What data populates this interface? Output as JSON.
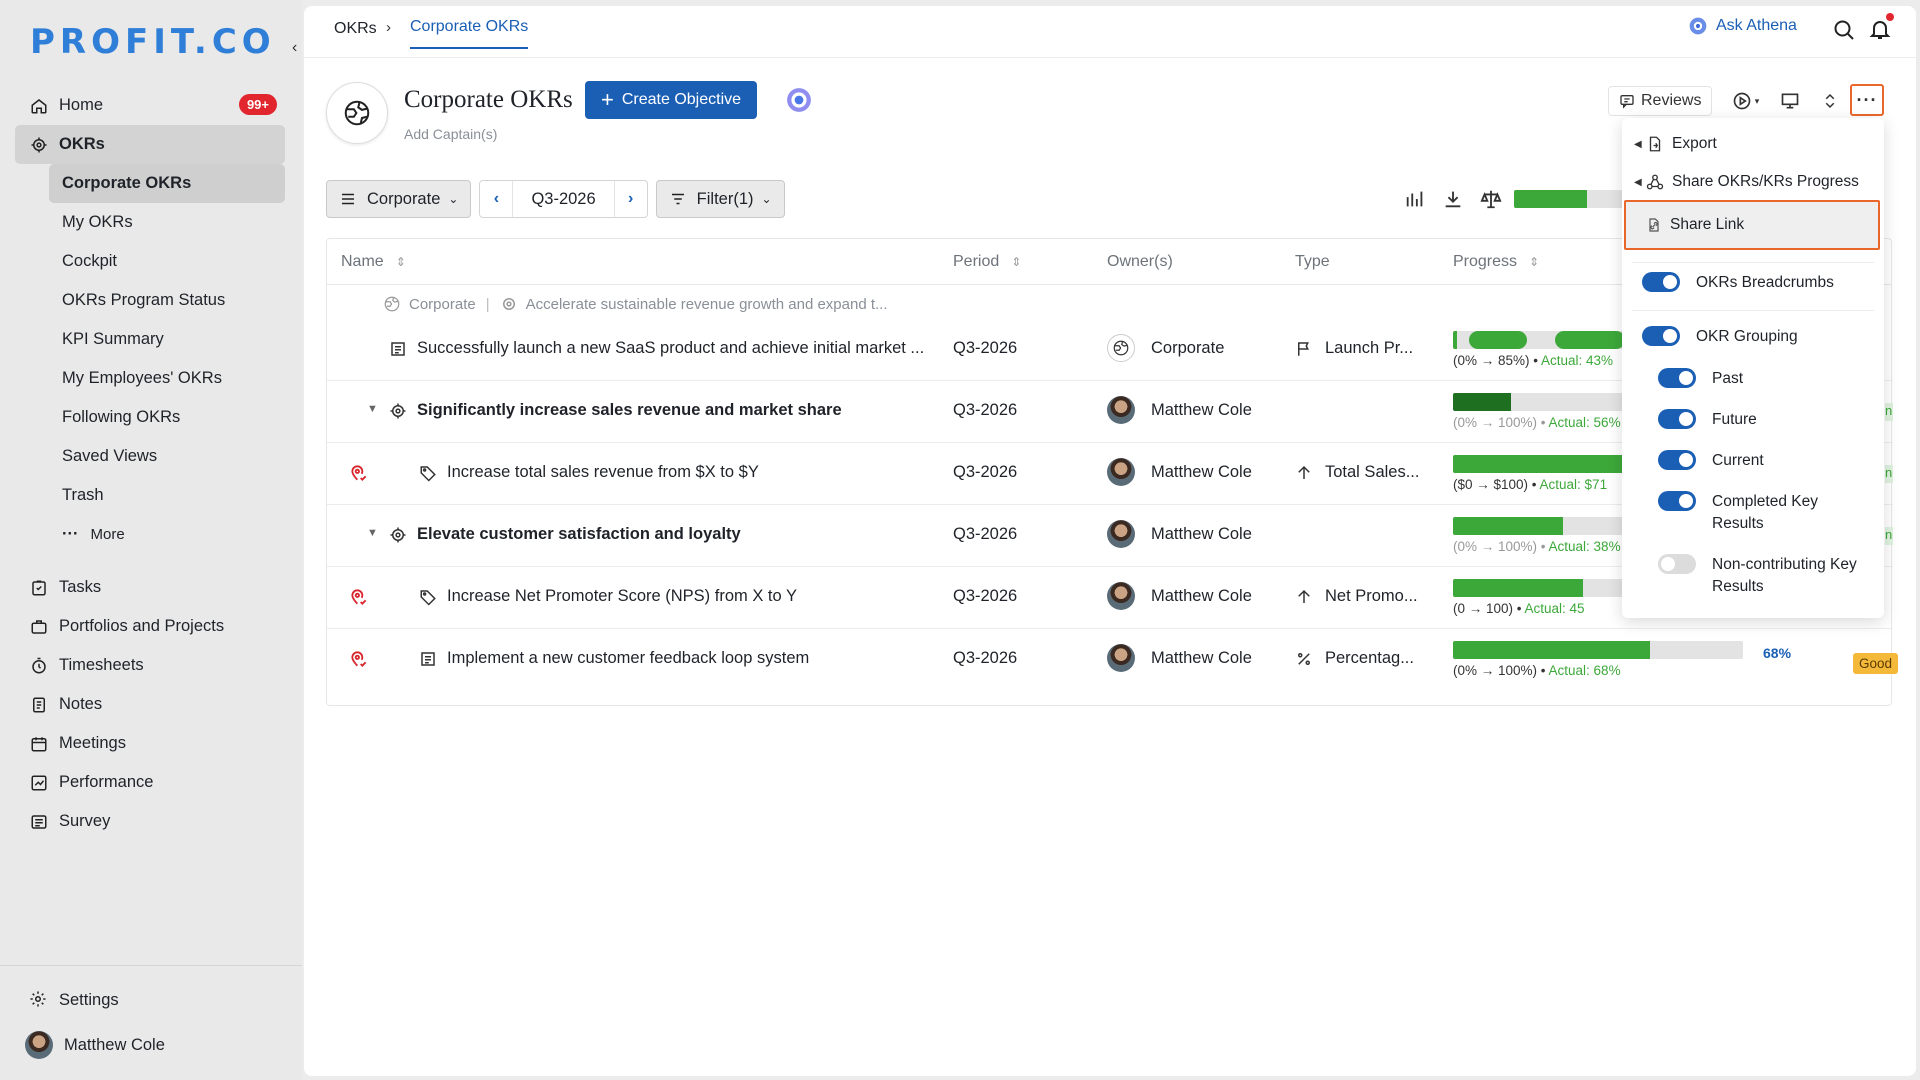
{
  "sidebar": {
    "logo": "PROFIT.CO",
    "items": [
      {
        "label": "Home",
        "badge": "99+",
        "icon": "home-icon"
      },
      {
        "label": "OKRs",
        "icon": "target-icon"
      }
    ],
    "okr_sub": [
      "Corporate OKRs",
      "My OKRs",
      "Cockpit",
      "OKRs Program Status",
      "KPI Summary",
      "My Employees' OKRs",
      "Following OKRs",
      "Saved Views",
      "Trash",
      "More"
    ],
    "more_glyph": "···",
    "lower_items": [
      "Tasks",
      "Portfolios and Projects",
      "Timesheets",
      "Notes",
      "Meetings",
      "Performance",
      "Survey"
    ],
    "settings": "Settings",
    "user": "Matthew Cole"
  },
  "topbar": {
    "crumb_root": "OKRs",
    "crumb_current": "Corporate OKRs",
    "ask_athena": "Ask Athena"
  },
  "header": {
    "title": "Corporate OKRs",
    "create_button": "Create Objective",
    "add_captains": "Add Captain(s)",
    "reviews": "Reviews",
    "more": "···"
  },
  "filters": {
    "scope": "Corporate",
    "period": "Q3-2026",
    "filter": "Filter(1)",
    "overall_progress": 0.56
  },
  "table": {
    "columns": {
      "name": "Name",
      "period": "Period",
      "owners": "Owner(s)",
      "type": "Type",
      "progress": "Progress"
    },
    "breadcrumb": {
      "level": "Corporate",
      "objective": "Accelerate sustainable revenue growth and expand t..."
    },
    "rows": [
      {
        "name": "Successfully launch a new SaaS product and achieve initial market ...",
        "period": "Q3-2026",
        "owner": "Corporate",
        "type": "Launch Pr...",
        "range": "(0% → 85%)",
        "actual": "Actual: 43%",
        "progress": 0.43
      },
      {
        "name": "Significantly increase sales revenue and market share",
        "period": "Q3-2026",
        "owner": "Matthew Cole",
        "type": "",
        "range": "(0% → 100%)",
        "actual": "Actual: 56%",
        "progress": 0.56
      },
      {
        "name": "Increase total sales revenue from $X to $Y",
        "period": "Q3-2026",
        "owner": "Matthew Cole",
        "type": "Total Sales...",
        "range": "($0 → $100)",
        "actual": "Actual: $71",
        "progress": 0.71
      },
      {
        "name": "Elevate customer satisfaction and loyalty",
        "period": "Q3-2026",
        "owner": "Matthew Cole",
        "type": "",
        "range": "(0% → 100%)",
        "actual": "Actual: 38%",
        "progress": 0.38
      },
      {
        "name": "Increase Net Promoter Score (NPS) from X to Y",
        "period": "Q3-2026",
        "owner": "Matthew Cole",
        "type": "Net Promo...",
        "range": "(0 → 100)",
        "actual": "Actual: 45",
        "progress": 0.45
      },
      {
        "name": "Implement a new customer feedback loop system",
        "period": "Q3-2026",
        "owner": "Matthew Cole",
        "type": "Percentag...",
        "range": "(0% → 100%)",
        "actual": "Actual: 68%",
        "progress": 0.68,
        "pct": "68%",
        "status": "Good"
      }
    ],
    "edge_mark": "n"
  },
  "menu": {
    "export": "Export",
    "share_progress": "Share OKRs/KRs Progress",
    "share_link": "Share Link",
    "toggles": [
      {
        "label": "OKRs Breadcrumbs",
        "on": true
      },
      {
        "label": "OKR Grouping",
        "on": true
      },
      {
        "label": "Past",
        "on": true
      },
      {
        "label": "Future",
        "on": true
      },
      {
        "label": "Current",
        "on": true
      },
      {
        "label": "Completed Key Results",
        "on": true
      },
      {
        "label": "Non-contributing Key Results",
        "on": false
      }
    ]
  },
  "colors": {
    "accent": "#1b5fb5",
    "progress": "#3da83a",
    "highlight": "#e9672b",
    "badge": "#e1262d"
  }
}
